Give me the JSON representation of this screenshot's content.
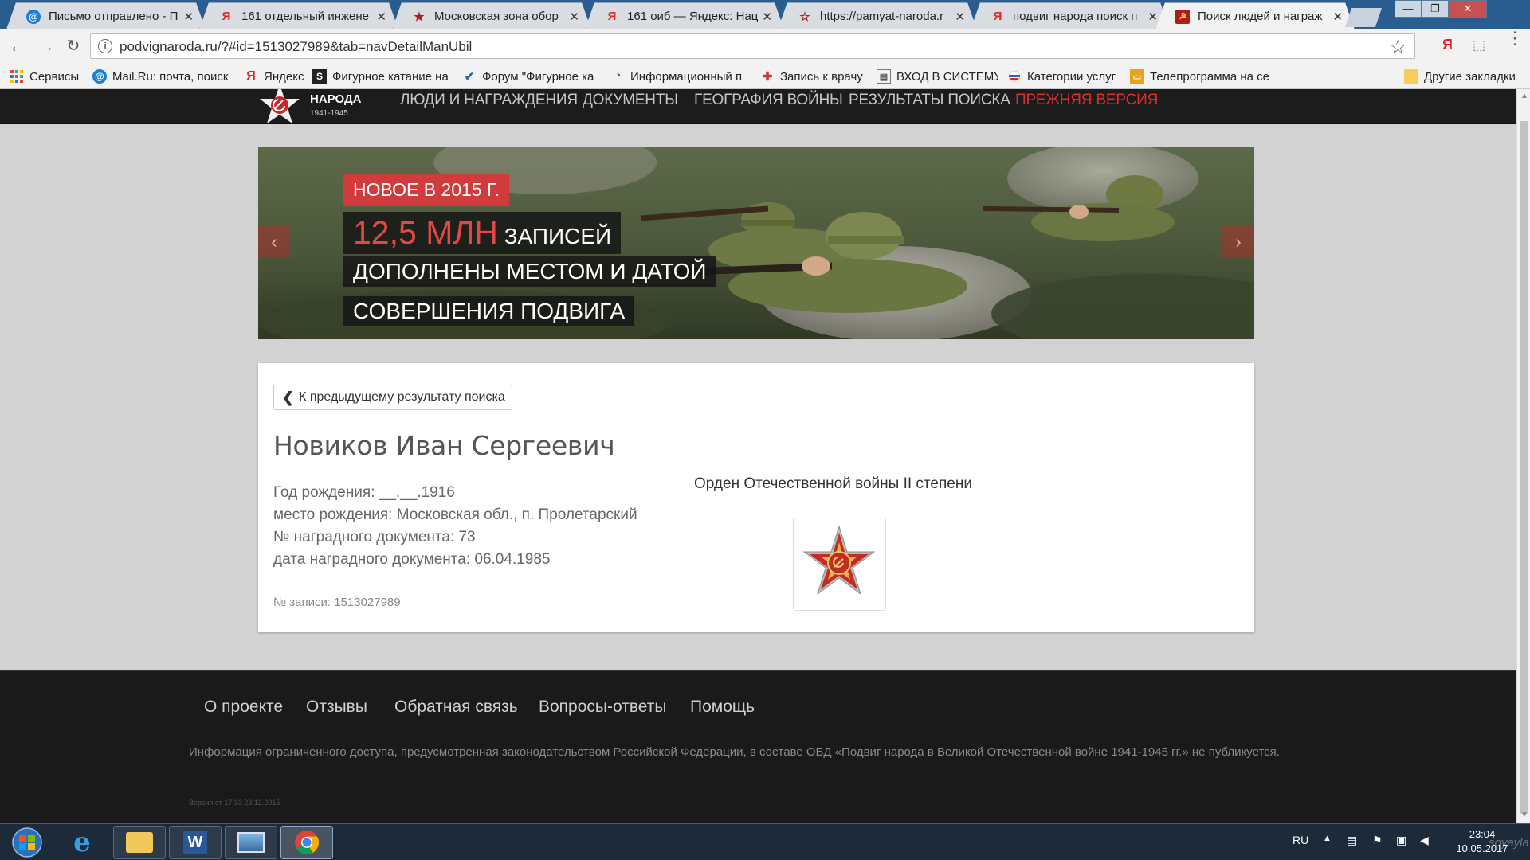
{
  "browser": {
    "tabs": [
      {
        "title": "Письмо отправлено - П",
        "icon": "mail-icon"
      },
      {
        "title": "161 отдельный инжене",
        "icon": "yandex-icon"
      },
      {
        "title": "Московская зона обор",
        "icon": "star-icon"
      },
      {
        "title": "161 оиб — Яндекс: Нац",
        "icon": "yandex-icon"
      },
      {
        "title": "https://pamyat-naroda.r",
        "icon": "star-icon"
      },
      {
        "title": "подвиг народа поиск п",
        "icon": "yandex-icon"
      },
      {
        "title": "Поиск людей и награж",
        "icon": "podvig-icon",
        "active": true
      }
    ],
    "url": "podvignaroda.ru/?#id=1513027989&tab=navDetailManUbil",
    "bookmarks": [
      {
        "label": "Сервисы",
        "icon": "apps-grid-icon"
      },
      {
        "label": "Mail.Ru: почта, поиск",
        "icon": "mail-icon"
      },
      {
        "label": "Яндекс",
        "icon": "yandex-icon"
      },
      {
        "label": "Фигурное катание на",
        "icon": "figure-skating-icon"
      },
      {
        "label": "Форум \"Фигурное ка",
        "icon": "forum-icon"
      },
      {
        "label": "Информационный п",
        "icon": "info-portal-icon"
      },
      {
        "label": "Запись к врачу",
        "icon": "doctor-icon"
      },
      {
        "label": "ВХОД В СИСТЕМУ",
        "icon": "login-icon"
      },
      {
        "label": "Категории услуг",
        "icon": "russia-flag-icon"
      },
      {
        "label": "Телепрограмма на се",
        "icon": "tv-icon"
      },
      {
        "label": "Другие закладки",
        "icon": "folder-icon"
      }
    ],
    "ext_label": "Я"
  },
  "site": {
    "logo_text": "НАРОДА",
    "logo_years": "1941-1945",
    "nav": [
      {
        "label": "ЛЮДИ И НАГРАЖДЕНИЯ"
      },
      {
        "label": "ДОКУМЕНТЫ"
      },
      {
        "label": "ГЕОГРАФИЯ ВОЙНЫ"
      },
      {
        "label": "РЕЗУЛЬТАТЫ ПОИСКА"
      },
      {
        "label": "ПРЕЖНЯЯ ВЕРСИЯ"
      }
    ],
    "banner": {
      "badge": "НОВОЕ В 2015 Г.",
      "big": "12,5 МЛН",
      "line1": " ЗАПИСЕЙ",
      "line2": "ДОПОЛНЕНЫ МЕСТОМ И ДАТОЙ",
      "line3": "СОВЕРШЕНИЯ ПОДВИГА"
    },
    "card": {
      "back_label": "К предыдущему результату поиска",
      "name": "Новиков Иван Сергеевич",
      "details": [
        "Год рождения: __.__.1916",
        "место рождения: Московская обл., п. Пролетарский",
        "№ наградного документа: 73",
        "дата наградного документа: 06.04.1985"
      ],
      "record": "№ записи: 1513027989",
      "award": "Орден Отечественной войны II степени"
    },
    "footer": {
      "links": [
        "О проекте",
        "Отзывы",
        "Обратная связь",
        "Вопросы-ответы",
        "Помощь"
      ],
      "note": "Информация ограниченного доступа, предусмотренная законодательством Российской Федерации, в составе ОБД «Подвиг народа в Великой Отечественной войне 1941-1945 гг.» не публикуется.",
      "version": "Версия от 17:33 23.12.2015"
    }
  },
  "taskbar": {
    "lang": "RU",
    "time": "23:04",
    "date": "10.05.2017",
    "watermark": "soyayla"
  },
  "colors": {
    "accent_red": "#d23b3b",
    "nav_bg": "#1c1c1c"
  }
}
